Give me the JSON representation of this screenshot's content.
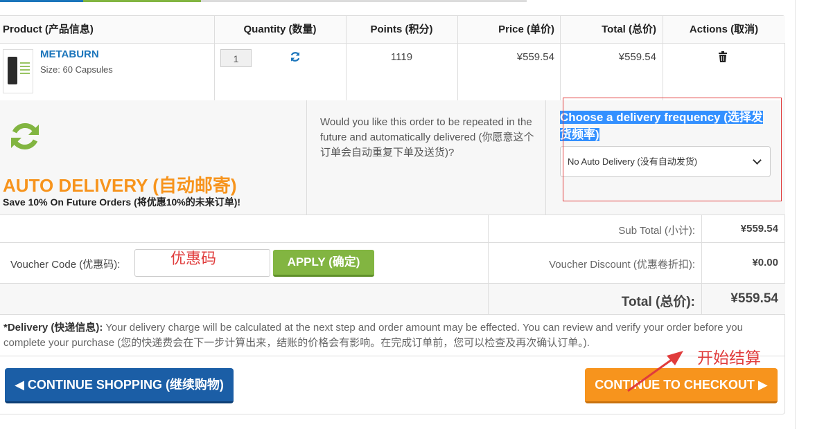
{
  "table": {
    "headers": {
      "product": "Product (产品信息)",
      "quantity": "Quantity (数量)",
      "points": "Points (积分)",
      "price": "Price (单价)",
      "total": "Total (总价)",
      "actions": "Actions (取消)"
    },
    "rows": [
      {
        "name": "METABURN",
        "size": "Size: 60 Capsules",
        "quantity": "1",
        "points": "1119",
        "price": "¥559.54",
        "total": "¥559.54"
      }
    ]
  },
  "auto_delivery": {
    "title": "AUTO DELIVERY (自动邮寄)",
    "subtitle": "Save 10% On Future Orders (将优惠10%的未来订单)!",
    "question": "Would you like this order to be repeated in the future and automatically delivered (你愿意这个订单会自动重复下单及送货)?",
    "frequency_title": "Choose a delivery frequency (选择发货频率)",
    "frequency_selected": "No Auto Delivery (没有自动发货)"
  },
  "summary": {
    "subtotal_label": "Sub Total (小计):",
    "subtotal_value": "¥559.54",
    "voucher_label": "Voucher Code (优惠码):",
    "voucher_placeholder": "",
    "voucher_annotation": "优惠码",
    "apply_label": "APPLY (确定)",
    "discount_label": "Voucher Discount (优惠卷折扣):",
    "discount_value": "¥0.00",
    "total_label": "Total (总价):",
    "total_value": "¥559.54"
  },
  "delivery_note": {
    "bold": "*Delivery (快递信息):",
    "text": " Your delivery charge will be calculated at the next step and order amount may be effected. You can review and verify your order before you complete your purchase (您的快递费会在下一步计算出来，结账的价格会有影响。在完成订单前，您可以检查及再次确认订单。)."
  },
  "buttons": {
    "continue_shopping": "CONTINUE SHOPPING (继续购物)",
    "checkout": "CONTINUE TO CHECKOUT",
    "checkout_annotation": "开始结算"
  },
  "colors": {
    "accent_blue": "#1b75bb",
    "accent_green": "#82b541",
    "accent_orange": "#f7941d",
    "annotation_red": "#e03c3c"
  }
}
